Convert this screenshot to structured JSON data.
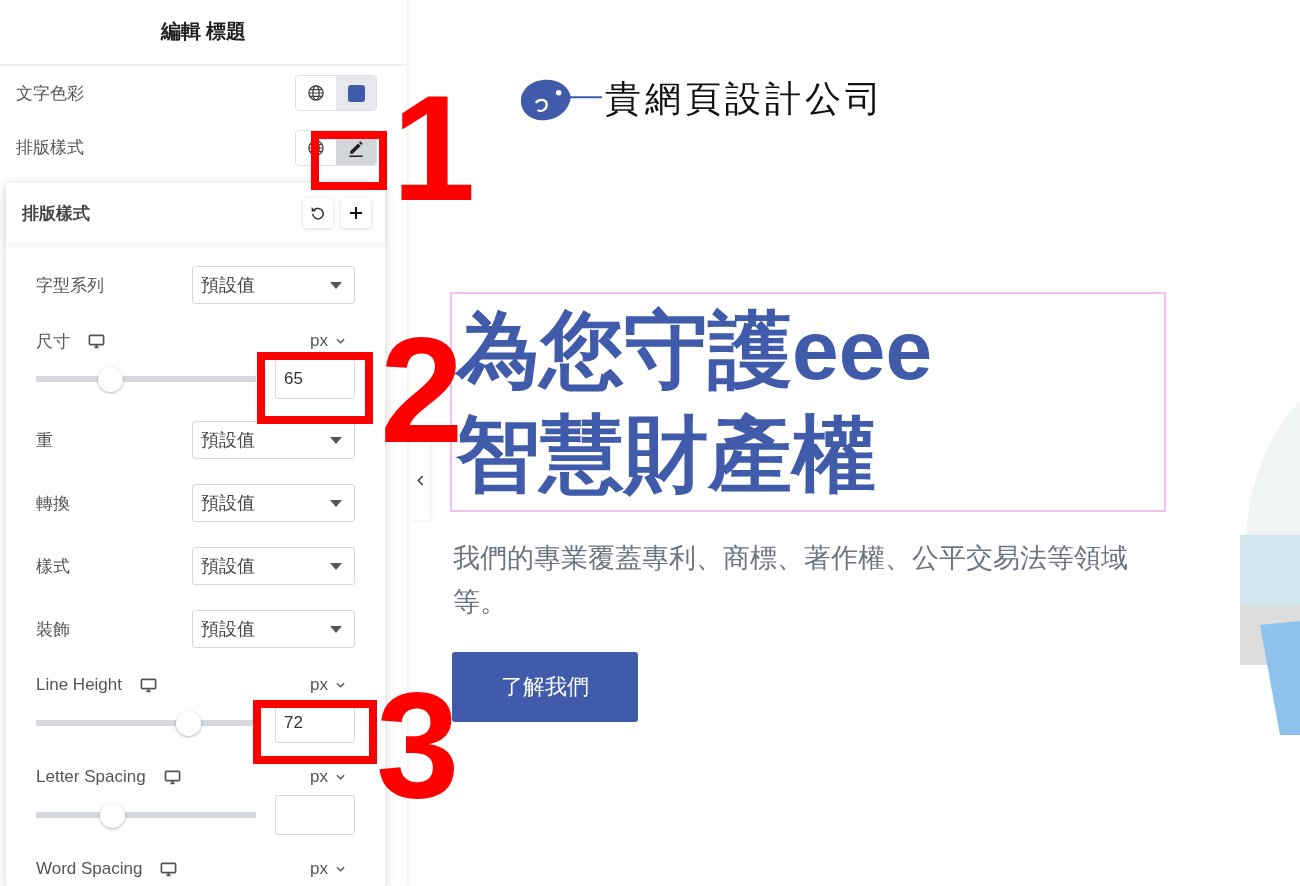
{
  "panel": {
    "title": "編輯 標題",
    "controls": [
      {
        "label": "文字色彩",
        "kind": "color",
        "color": "#3f5ba9",
        "selected": false
      },
      {
        "label": "排版樣式",
        "kind": "edit",
        "selected": true
      }
    ]
  },
  "popover": {
    "title": "排版樣式",
    "fields": [
      {
        "kind": "select",
        "label": "字型系列",
        "value": "預設值"
      },
      {
        "kind": "slider",
        "label": "尺寸",
        "unit": "px",
        "level": 0.32,
        "value": "65"
      },
      {
        "kind": "select",
        "label": "重",
        "value": "預設值"
      },
      {
        "kind": "select",
        "label": "轉換",
        "value": "預設值"
      },
      {
        "kind": "select",
        "label": "樣式",
        "value": "預設值"
      },
      {
        "kind": "select",
        "label": "裝飾",
        "value": "預設值"
      },
      {
        "kind": "slider",
        "label": "Line Height",
        "unit": "px",
        "level": 0.72,
        "value": "72"
      },
      {
        "kind": "slider",
        "label": "Letter Spacing",
        "unit": "px",
        "level": 0.33
      },
      {
        "kind": "slider",
        "label": "Word Spacing",
        "unit": "px"
      }
    ]
  },
  "page": {
    "logo_text": "貴網頁設計公司",
    "heading": {
      "lines": [
        "為您守護eee",
        "智慧財產權"
      ],
      "selected": true
    },
    "paragraph": "我們的專業覆蓋專利、商標、著作權、公平交易法等領域等。",
    "button": "了解我們"
  },
  "annotations": [
    {
      "label": "1"
    },
    {
      "label": "2"
    },
    {
      "label": "3"
    }
  ]
}
